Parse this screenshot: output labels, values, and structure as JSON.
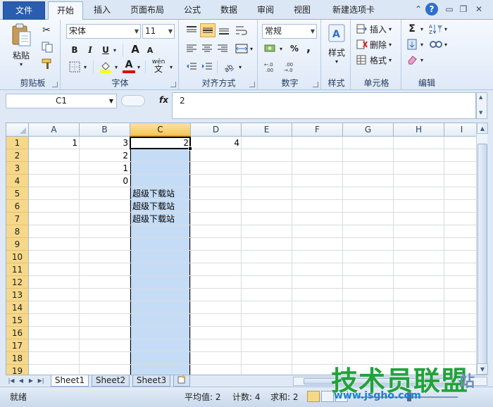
{
  "tabs": {
    "file": "文件",
    "items": [
      "开始",
      "插入",
      "页面布局",
      "公式",
      "数据",
      "审阅",
      "视图",
      "新建选项卡"
    ],
    "active": "开始"
  },
  "ribbon": {
    "clipboard": {
      "label": "剪贴板",
      "paste": "粘贴"
    },
    "font": {
      "label": "字体",
      "name": "宋体",
      "size": "11",
      "bold": "B",
      "italic": "I",
      "underline": "U",
      "grow": "A",
      "shrink": "A",
      "color_a": "A",
      "wen": "wén",
      "wen_char": "文"
    },
    "alignment": {
      "label": "对齐方式"
    },
    "number": {
      "label": "数字",
      "format": "常规",
      "percent": "%",
      "comma": ","
    },
    "styles": {
      "label": "样式",
      "button": "样式"
    },
    "cells": {
      "label": "单元格",
      "insert": "插入",
      "delete": "删除",
      "format": "格式"
    },
    "editing": {
      "label": "编辑",
      "sum": "Σ"
    }
  },
  "formula_bar": {
    "name_box": "C1",
    "fx": "fx",
    "value": "2"
  },
  "grid": {
    "columns": [
      "A",
      "B",
      "C",
      "D",
      "E",
      "F",
      "G",
      "H",
      "I"
    ],
    "selected_column": "C",
    "rows": [
      "1",
      "2",
      "3",
      "4",
      "5",
      "6",
      "7",
      "8",
      "9",
      "10",
      "11",
      "12",
      "13",
      "14",
      "15",
      "16",
      "17",
      "18",
      "19"
    ],
    "cells": {
      "A1": "1",
      "B1": "3",
      "B2": "2",
      "B3": "1",
      "B4": "0",
      "C1": "2",
      "C5": "超级下载站",
      "C6": "超级下载站",
      "C7": "超级下载站",
      "D1": "4"
    }
  },
  "sheets": {
    "tabs": [
      "Sheet1",
      "Sheet2",
      "Sheet3"
    ],
    "active": "Sheet1"
  },
  "status": {
    "mode": "就绪",
    "average": "平均值: 2",
    "count": "计数: 4",
    "sum": "求和: 2"
  },
  "watermark": {
    "title": "技术员联盟",
    "url": "www.jsgho.com",
    "badge": "站"
  },
  "colors": {
    "accent": "#2a5db0",
    "selection": "#c5dcf6",
    "row_header_selected": "#f6d88a"
  }
}
